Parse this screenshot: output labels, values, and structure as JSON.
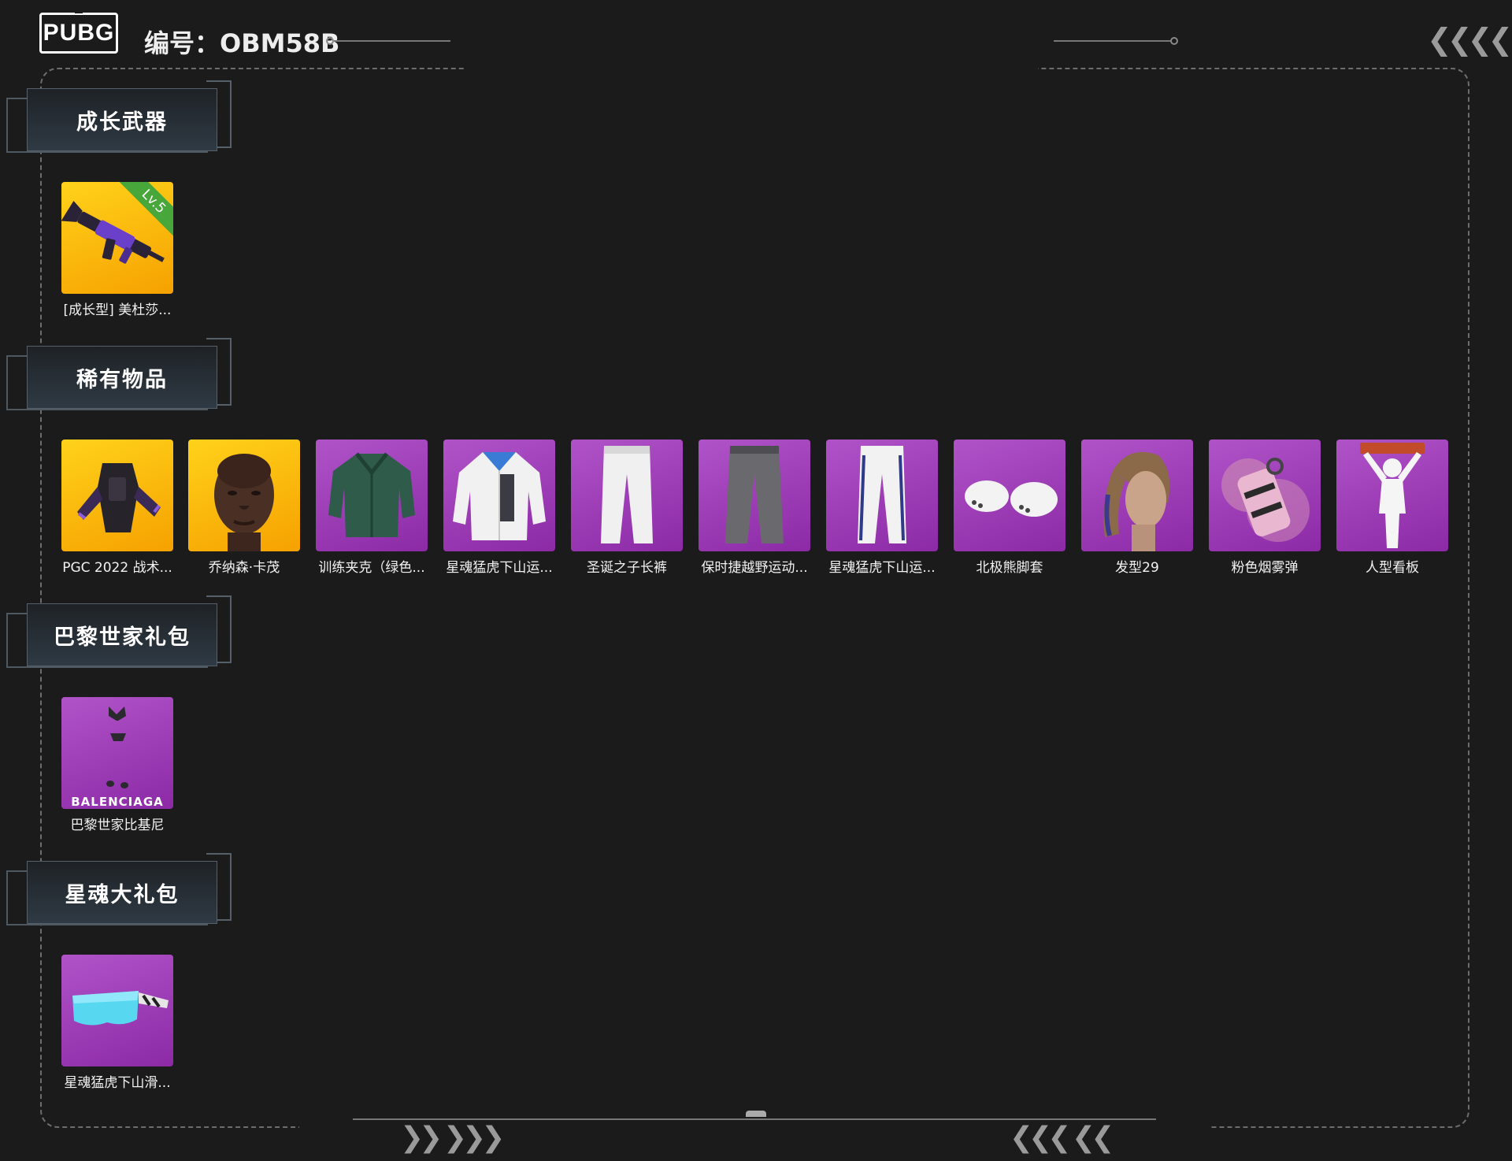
{
  "header": {
    "logo_text": "PUBG",
    "serial": "编号：OBM58B"
  },
  "colors": {
    "background": "#1b1b1c",
    "rarity_gold": "#f7b500",
    "rarity_purple": "#a443bf",
    "level_badge": "#48a73a"
  },
  "sections": [
    {
      "title": "成长武器",
      "items": [
        {
          "label": "[成长型] 美杜莎...",
          "rarity": "gold",
          "icon": "rifle-icon",
          "badge": "Lv.5"
        }
      ]
    },
    {
      "title": "稀有物品",
      "items": [
        {
          "label": "PGC 2022 战术...",
          "rarity": "gold",
          "icon": "tactical-vest-icon"
        },
        {
          "label": "乔纳森·卡茂",
          "rarity": "gold",
          "icon": "character-face-icon"
        },
        {
          "label": "训练夹克（绿色...",
          "rarity": "purple",
          "icon": "green-jacket-icon"
        },
        {
          "label": "星魂猛虎下山运...",
          "rarity": "purple",
          "icon": "white-jacket-icon"
        },
        {
          "label": "圣诞之子长裤",
          "rarity": "purple",
          "icon": "white-pants-icon"
        },
        {
          "label": "保时捷越野运动...",
          "rarity": "purple",
          "icon": "grey-pants-icon"
        },
        {
          "label": "星魂猛虎下山运...",
          "rarity": "purple",
          "icon": "track-pants-icon"
        },
        {
          "label": "北极熊脚套",
          "rarity": "purple",
          "icon": "bear-paw-shoes-icon"
        },
        {
          "label": "发型29",
          "rarity": "purple",
          "icon": "hairstyle-icon"
        },
        {
          "label": "粉色烟雾弹",
          "rarity": "purple",
          "icon": "smoke-grenade-icon"
        },
        {
          "label": "人型看板",
          "rarity": "purple",
          "icon": "human-signboard-icon"
        }
      ]
    },
    {
      "title": "巴黎世家礼包",
      "items": [
        {
          "label": "巴黎世家比基尼",
          "rarity": "purple",
          "icon": "bikini-icon",
          "brand": "BALENCIAGA"
        }
      ]
    },
    {
      "title": "星魂大礼包",
      "items": [
        {
          "label": "星魂猛虎下山滑...",
          "rarity": "purple",
          "icon": "ski-goggles-icon"
        }
      ]
    }
  ]
}
